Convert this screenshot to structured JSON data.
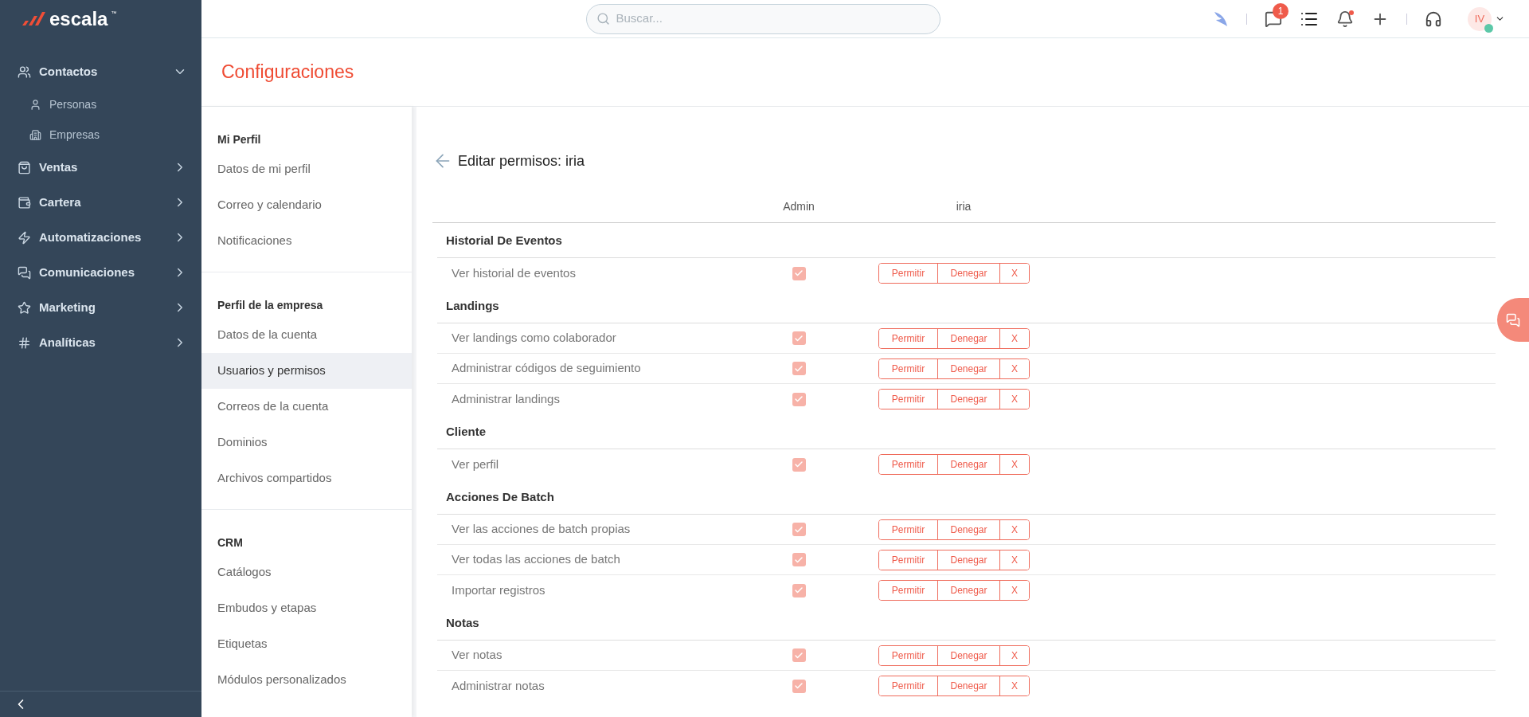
{
  "brand": {
    "name": "escala",
    "mark": "™"
  },
  "nav": [
    {
      "label": "Contactos",
      "expanded": true,
      "children": [
        {
          "label": "Personas"
        },
        {
          "label": "Empresas"
        }
      ]
    },
    {
      "label": "Ventas",
      "expanded": false
    },
    {
      "label": "Cartera",
      "expanded": false
    },
    {
      "label": "Automatizaciones",
      "expanded": false
    },
    {
      "label": "Comunicaciones",
      "expanded": false
    },
    {
      "label": "Marketing",
      "expanded": false
    },
    {
      "label": "Analíticas",
      "expanded": false
    }
  ],
  "search": {
    "placeholder": "Buscar..."
  },
  "topbar": {
    "messages_badge": "1",
    "avatar": "IV"
  },
  "page_title": "Configuraciones",
  "settings_menu": [
    {
      "title": "Mi Perfil",
      "items": [
        {
          "label": "Datos de mi perfil",
          "selected": false
        },
        {
          "label": "Correo y calendario",
          "selected": false
        },
        {
          "label": "Notificaciones",
          "selected": false
        }
      ]
    },
    {
      "title": "Perfil de la empresa",
      "items": [
        {
          "label": "Datos de la cuenta",
          "selected": false
        },
        {
          "label": "Usuarios y permisos",
          "selected": true
        },
        {
          "label": "Correos de la cuenta",
          "selected": false
        },
        {
          "label": "Dominios",
          "selected": false
        },
        {
          "label": "Archivos compartidos",
          "selected": false
        }
      ]
    },
    {
      "title": "CRM",
      "items": [
        {
          "label": "Catálogos",
          "selected": false
        },
        {
          "label": "Embudos y etapas",
          "selected": false
        },
        {
          "label": "Etiquetas",
          "selected": false
        },
        {
          "label": "Módulos personalizados",
          "selected": false
        }
      ]
    }
  ],
  "editor": {
    "title": "Editar permisos: iria",
    "columns": [
      "Admin",
      "iria"
    ],
    "sections": [
      {
        "title": "Historial De Eventos",
        "rows": [
          {
            "label": "Ver historial de eventos",
            "checked": true,
            "actions": [
              "Permitir",
              "Denegar",
              "X"
            ]
          }
        ]
      },
      {
        "title": "Landings",
        "rows": [
          {
            "label": "Ver landings como colaborador",
            "checked": true,
            "actions": [
              "Permitir",
              "Denegar",
              "X"
            ]
          },
          {
            "label": "Administrar códigos de seguimiento",
            "checked": true,
            "actions": [
              "Permitir",
              "Denegar",
              "X"
            ]
          },
          {
            "label": "Administrar landings",
            "checked": true,
            "actions": [
              "Permitir",
              "Denegar",
              "X"
            ]
          }
        ]
      },
      {
        "title": "Cliente",
        "rows": [
          {
            "label": "Ver perfil",
            "checked": true,
            "actions": [
              "Permitir",
              "Denegar",
              "X"
            ]
          }
        ]
      },
      {
        "title": "Acciones De Batch",
        "rows": [
          {
            "label": "Ver las acciones de batch propias",
            "checked": true,
            "actions": [
              "Permitir",
              "Denegar",
              "X"
            ]
          },
          {
            "label": "Ver todas las acciones de batch",
            "checked": true,
            "actions": [
              "Permitir",
              "Denegar",
              "X"
            ]
          },
          {
            "label": "Importar registros",
            "checked": true,
            "actions": [
              "Permitir",
              "Denegar",
              "X"
            ]
          }
        ]
      },
      {
        "title": "Notas",
        "rows": [
          {
            "label": "Ver notas",
            "checked": true,
            "actions": [
              "Permitir",
              "Denegar",
              "X"
            ]
          },
          {
            "label": "Administrar notas",
            "checked": true,
            "actions": [
              "Permitir",
              "Denegar",
              "X"
            ]
          }
        ]
      }
    ]
  }
}
